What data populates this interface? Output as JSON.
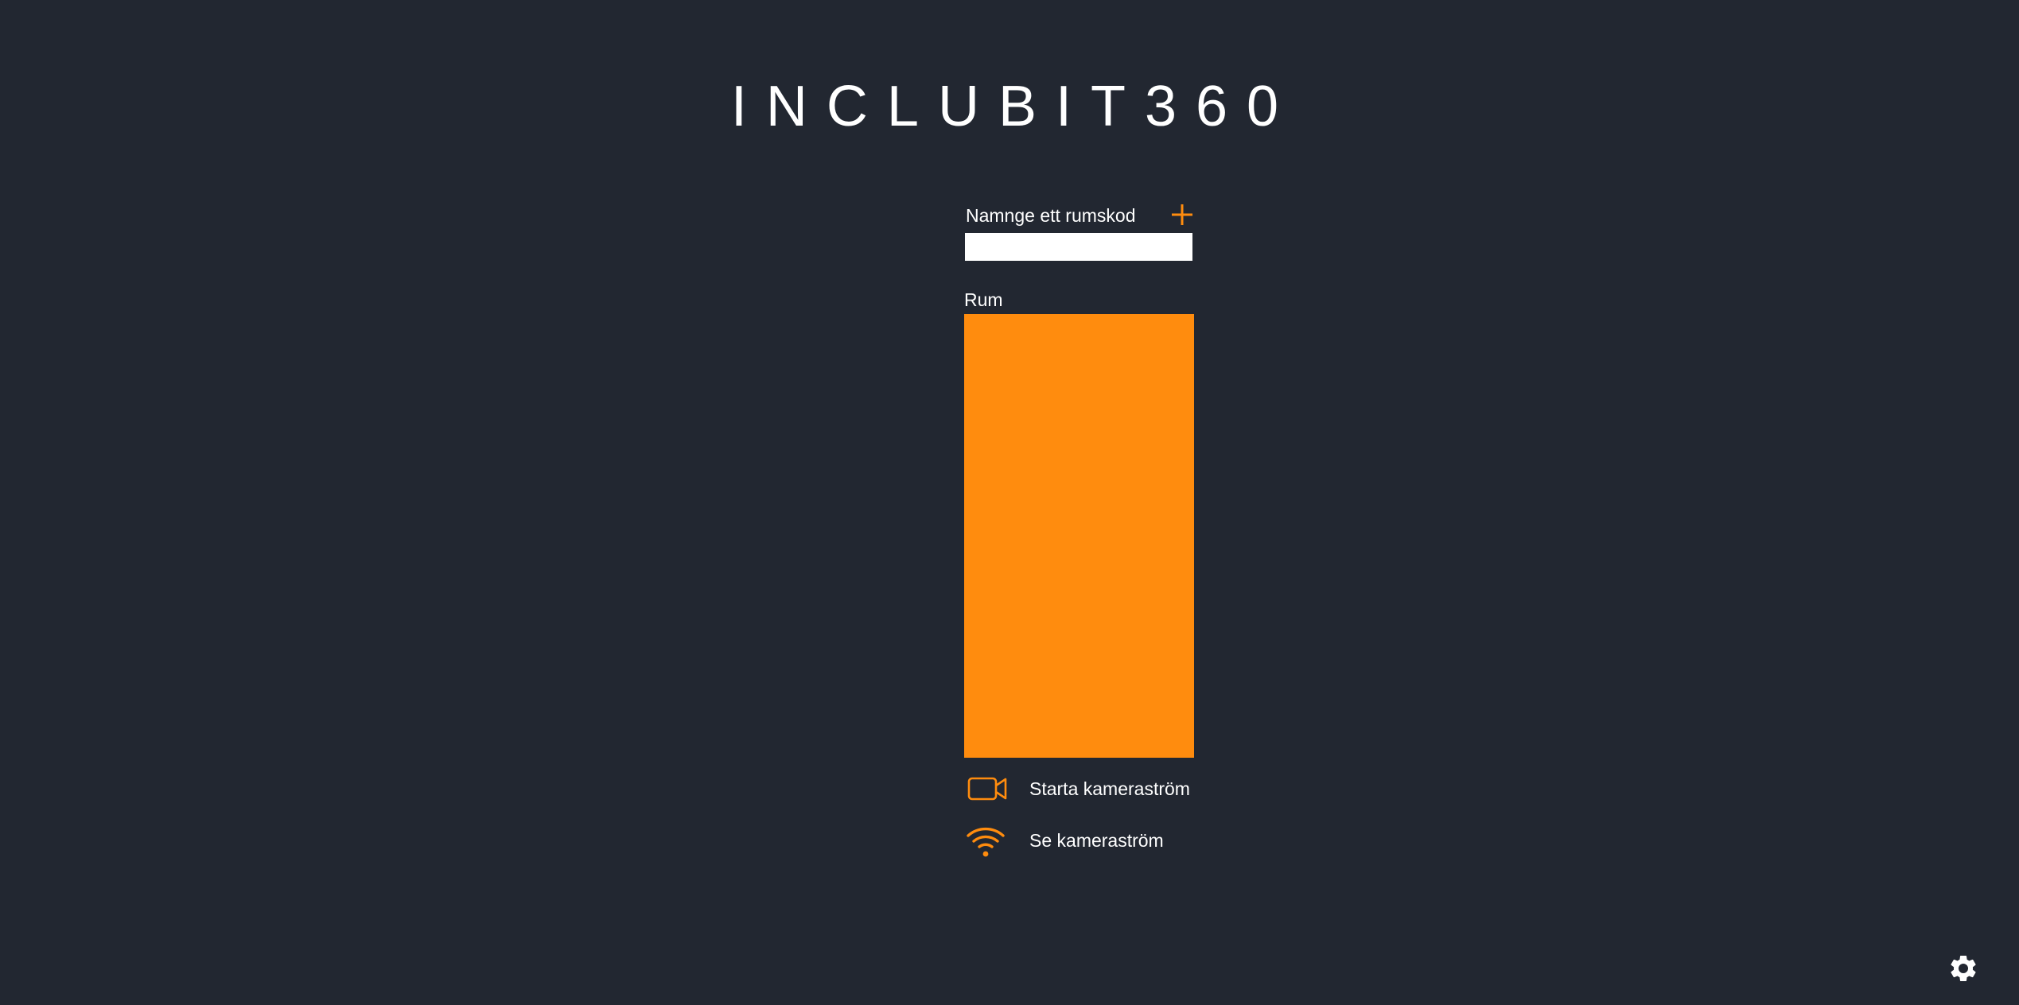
{
  "app": {
    "title": "INCLUBIT360"
  },
  "room_code": {
    "label": "Namnge ett rumskod",
    "value": "",
    "add_icon": "plus-icon"
  },
  "rooms": {
    "label": "Rum",
    "items": []
  },
  "actions": {
    "start_stream": {
      "label": "Starta kameraström",
      "icon": "video-camera-icon"
    },
    "view_stream": {
      "label": "Se kameraström",
      "icon": "wifi-icon"
    }
  },
  "settings": {
    "icon": "gear-icon"
  },
  "colors": {
    "background": "#222731",
    "accent": "#ff8c0e",
    "text": "#ffffff"
  }
}
